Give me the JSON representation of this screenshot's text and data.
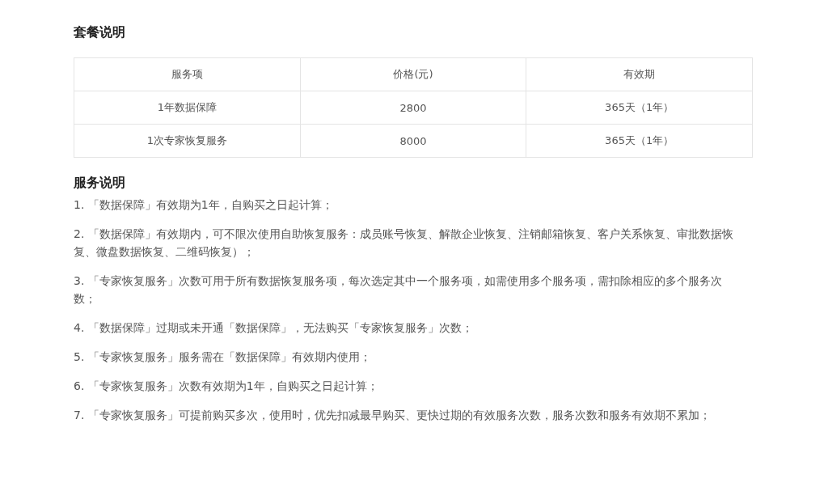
{
  "package_section": {
    "heading": "套餐说明",
    "table": {
      "columns": [
        "服务项",
        "价格(元)",
        "有效期"
      ],
      "rows": [
        [
          "1年数据保障",
          "2800",
          "365天（1年）"
        ],
        [
          "1次专家恢复服务",
          "8000",
          "365天（1年）"
        ]
      ]
    }
  },
  "service_section": {
    "heading": "服务说明",
    "items": [
      "1. 「数据保障」有效期为1年，自购买之日起计算；",
      "2. 「数据保障」有效期内，可不限次使用自助恢复服务：成员账号恢复、解散企业恢复、注销邮箱恢复、客户关系恢复、审批数据恢复、微盘数据恢复、二维码恢复）；",
      "3. 「专家恢复服务」次数可用于所有数据恢复服务项，每次选定其中一个服务项，如需使用多个服务项，需扣除相应的多个服务次数；",
      "4. 「数据保障」过期或未开通「数据保障」，无法购买「专家恢复服务」次数；",
      "5. 「专家恢复服务」服务需在「数据保障」有效期内使用；",
      "6. 「专家恢复服务」次数有效期为1年，自购买之日起计算；",
      "7. 「专家恢复服务」可提前购买多次，使用时，优先扣减最早购买、更快过期的有效服务次数，服务次数和服务有效期不累加；"
    ]
  }
}
